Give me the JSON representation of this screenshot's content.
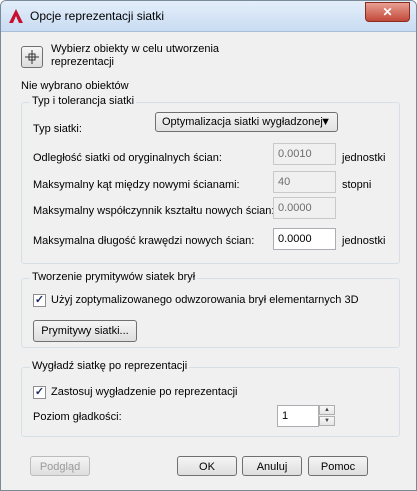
{
  "window": {
    "title": "Opcje reprezentacji siatki",
    "close_glyph": "✕"
  },
  "pick": {
    "label": "Wybierz obiekty w celu utworzenia reprezentacji",
    "icon": "crosshair-icon"
  },
  "status": "Nie wybrano obiektów",
  "mesh_group": {
    "title": "Typ i tolerancja siatki",
    "type_label": "Typ siatki:",
    "type_value": "Optymalizacja siatki wygładzonej",
    "distance_label": "Odległość siatki od oryginalnych ścian:",
    "distance_value": "0.0010",
    "distance_unit": "jednostki",
    "angle_label": "Maksymalny kąt między nowymi ścianami:",
    "angle_value": "40",
    "angle_unit": "stopni",
    "aspect_label": "Maksymalny współczynnik kształtu nowych ścian:",
    "aspect_value": "0.0000",
    "edge_label": "Maksymalna długość krawędzi nowych ścian:",
    "edge_value": "0.0000",
    "edge_unit": "jednostki"
  },
  "primitives_group": {
    "title": "Tworzenie prymitywów siatek brył",
    "checkbox_label": "Użyj zoptymalizowanego odwzorowania brył elementarnych 3D",
    "checked": true,
    "button_label": "Prymitywy siatki..."
  },
  "smooth_group": {
    "title": "Wygładź siatkę po reprezentacji",
    "checkbox_label": "Zastosuj wygładzenie po reprezentacji",
    "checked": true,
    "level_label": "Poziom gładkości:",
    "level_value": "1"
  },
  "footer": {
    "preview": "Podgląd",
    "ok": "OK",
    "cancel": "Anuluj",
    "help": "Pomoc"
  }
}
